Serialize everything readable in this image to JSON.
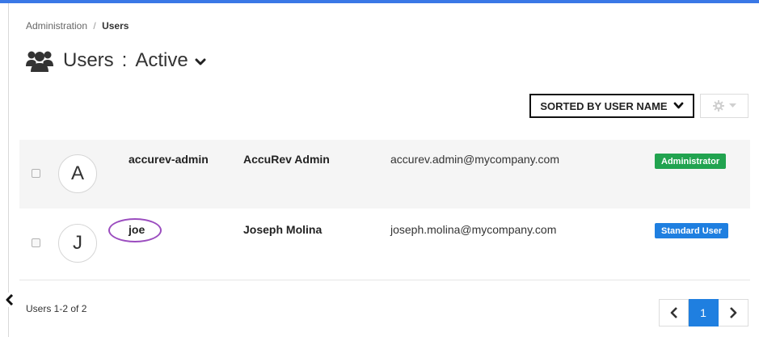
{
  "breadcrumb": {
    "parent": "Administration",
    "separator": "/",
    "current": "Users"
  },
  "header": {
    "title": "Users",
    "separator": ":",
    "filter": "Active",
    "icon": "users-icon"
  },
  "toolbar": {
    "sort_label": "SORTED BY USER NAME",
    "gear_icon": "gear-icon"
  },
  "users": [
    {
      "initial": "A",
      "username": "accurev-admin",
      "full_name": "AccuRev Admin",
      "email": "accurev.admin@mycompany.com",
      "role": "Administrator",
      "role_color": "#21a34f"
    },
    {
      "initial": "J",
      "username": "joe",
      "full_name": "Joseph Molina",
      "email": "joseph.molina@mycompany.com",
      "role": "Standard User",
      "role_color": "#1f7fe0"
    }
  ],
  "footer": {
    "count_text": "Users 1-2 of 2"
  },
  "pagination": {
    "current_page": "1"
  },
  "colors": {
    "accent": "#3a78e6",
    "highlight_ring": "#9b4dbf"
  }
}
